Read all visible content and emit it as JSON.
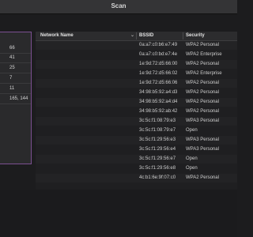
{
  "window": {
    "title": "Scan"
  },
  "left_list": {
    "items": [
      "66",
      "41",
      "25",
      "7",
      "11",
      "165, 144"
    ]
  },
  "table": {
    "headers": {
      "name": "Network Name",
      "bssid": "BSSID",
      "security": "Security"
    },
    "rows": [
      {
        "name": "",
        "bssid": "0a:a7:c0:b6:e7:49",
        "security": "WPA2 Personal"
      },
      {
        "name": "",
        "bssid": "0a:a7:c0:bd:e7:4e",
        "security": "WPA2 Enterprise"
      },
      {
        "name": "",
        "bssid": "1e:9d:72:d5:66:00",
        "security": "WPA2 Personal"
      },
      {
        "name": "",
        "bssid": "1e:9d:72:d5:66:02",
        "security": "WPA2 Enterprise"
      },
      {
        "name": "",
        "bssid": "1e:9d:72:d5:66:06",
        "security": "WPA2 Personal"
      },
      {
        "name": "",
        "bssid": "34:98:b5:92:a4:d3",
        "security": "WPA2 Personal"
      },
      {
        "name": "",
        "bssid": "34:98:b5:92:a4:d4",
        "security": "WPA2 Personal"
      },
      {
        "name": "",
        "bssid": "34:98:b5:92:ab:42",
        "security": "WPA2 Personal"
      },
      {
        "name": "",
        "bssid": "3c:5c:f1:08:79:e3",
        "security": "WPA3 Personal"
      },
      {
        "name": "",
        "bssid": "3c:5c:f1:08:79:e7",
        "security": "Open"
      },
      {
        "name": "",
        "bssid": "3c:5c:f1:29:56:e3",
        "security": "WPA3 Personal"
      },
      {
        "name": "",
        "bssid": "3c:5c:f1:29:56:e4",
        "security": "WPA3 Personal"
      },
      {
        "name": "",
        "bssid": "3c:5c:f1:29:56:e7",
        "security": "Open"
      },
      {
        "name": "",
        "bssid": "3c:5c:f1:29:56:e8",
        "security": "Open"
      },
      {
        "name": "",
        "bssid": "4c:b1:6e:9f:07:c0",
        "security": "WPA2 Personal"
      }
    ]
  }
}
